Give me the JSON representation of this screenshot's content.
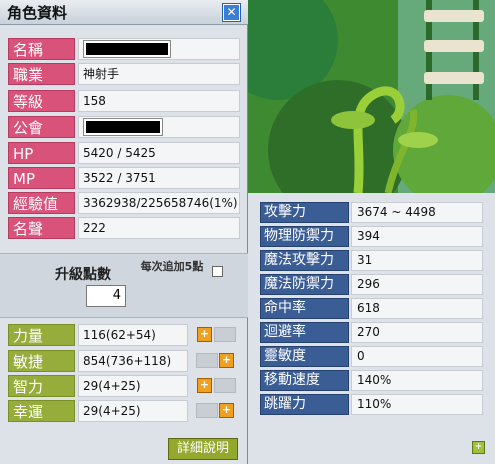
{
  "window": {
    "title": "角色資料"
  },
  "info": [
    {
      "label": "名稱",
      "value": ""
    },
    {
      "label": "職業",
      "value": "神射手"
    },
    {
      "label": "等級",
      "value": "158"
    },
    {
      "label": "公會",
      "value": ""
    },
    {
      "label": "HP",
      "value": "5420 / 5425"
    },
    {
      "label": "MP",
      "value": "3522 / 3751"
    },
    {
      "label": "經驗值",
      "value": "3362938/225658746(1%)"
    },
    {
      "label": "名聲",
      "value": "222"
    }
  ],
  "ap": {
    "title": "升級點數",
    "value": "4",
    "auto_label": "每次追加5點"
  },
  "stats": [
    {
      "label": "力量",
      "value": "116(62+54)"
    },
    {
      "label": "敏捷",
      "value": "854(736+118)"
    },
    {
      "label": "智力",
      "value": "29(4+25)"
    },
    {
      "label": "幸運",
      "value": "29(4+25)"
    }
  ],
  "detail_button": "詳細說明",
  "attack": [
    {
      "label": "攻擊力",
      "value": "3674 ~ 4498"
    },
    {
      "label": "物理防禦力",
      "value": "394"
    },
    {
      "label": "魔法攻擊力",
      "value": "31"
    },
    {
      "label": "魔法防禦力",
      "value": "296"
    },
    {
      "label": "命中率",
      "value": "618"
    },
    {
      "label": "迴避率",
      "value": "270"
    },
    {
      "label": "靈敏度",
      "value": "0"
    },
    {
      "label": "移動速度",
      "value": "140%"
    },
    {
      "label": "跳躍力",
      "value": "110%"
    }
  ],
  "icons": {
    "close": "close-icon",
    "plus": "plus-icon"
  },
  "colors": {
    "pink": "#d9527a",
    "green": "#97ad3b",
    "blue": "#3b5d96"
  }
}
